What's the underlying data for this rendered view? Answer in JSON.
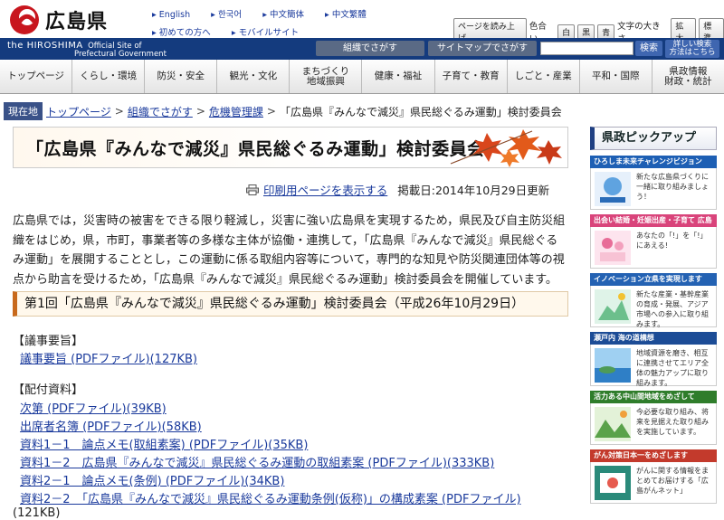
{
  "header": {
    "site_name": "広島県",
    "english_name": "the HIROSHIMA",
    "official_site": "Official Site of",
    "official_site_2": "Prefectural Government",
    "languages": [
      "English",
      "한국어",
      "中文簡体",
      "中文繁體"
    ],
    "links_row2": [
      "初めての方へ",
      "モバイルサイト"
    ],
    "read_aloud": "ページを読み上げ",
    "color_label": "色合い",
    "color_options": [
      "白",
      "黒",
      "青"
    ],
    "size_label": "文字の大きさ",
    "size_options": [
      "拡大",
      "標準"
    ]
  },
  "searchbar": {
    "org_search": "組織でさがす",
    "sitemap_search": "サイトマップでさがす",
    "search_button": "検索",
    "howto_1": "詳しい検索",
    "howto_2": "方法はこちら"
  },
  "global_nav": [
    {
      "label": "トップページ"
    },
    {
      "label": "くらし・環境"
    },
    {
      "label": "防災・安全"
    },
    {
      "label": "観光・文化"
    },
    {
      "label": "まちづくり\n地域振興"
    },
    {
      "label": "健康・福祉"
    },
    {
      "label": "子育て・教育"
    },
    {
      "label": "しごと・産業"
    },
    {
      "label": "平和・国際"
    },
    {
      "label": "県政情報\n財政・統計"
    }
  ],
  "breadcrumb": {
    "current_label": "現在地",
    "items": [
      "トップページ",
      "組織でさがす",
      "危機管理課"
    ],
    "current": "「広島県『みんなで減災』県民総ぐるみ運動」検討委員会"
  },
  "page": {
    "title": "「広島県『みんなで減災』県民総ぐるみ運動」検討委員会",
    "print_link": "印刷用ページを表示する",
    "published": "掲載日:2014年10月29日更新",
    "intro": "広島県では，災害時の被害をできる限り軽減し，災害に強い広島県を実現するため，県民及び自主防災組織をはじめ，県，市町，事業者等の多様な主体が協働・連携して，「広島県『みんなで減災』県民総ぐるみ運動」を展開することとし，この運動に係る取組内容等について，専門的な知見や防災関連団体等の視点から助言を受けるため，「広島県『みんなで減災』県民総ぐるみ運動」検討委員会を開催しています。",
    "section_title": "第1回「広島県『みんなで減災』県民総ぐるみ運動」検討委員会（平成26年10月29日）",
    "summary_heading": "【議事要旨】",
    "summary_link": "議事要旨 (PDFファイル)(127KB)",
    "materials_heading": "【配付資料】",
    "materials": [
      "次第 (PDFファイル)(39KB)",
      "出席者名簿 (PDFファイル)(58KB)",
      "資料1－1　論点メモ(取組素案) (PDFファイル)(35KB)",
      "資料1－2　広島県『みんなで減災』県民総ぐるみ運動の取組素案 (PDFファイル)(333KB)",
      "資料2－1　論点メモ(条例) (PDFファイル)(34KB)",
      "資料2－2　「広島県『みんなで減災』県民総ぐるみ運動条例(仮称)」の構成素案 (PDFファイル)"
    ],
    "trailing_size": "(121KB)"
  },
  "sidebar": {
    "heading": "県政ピックアップ",
    "banners": [
      {
        "title": "ひろしま未来チャレンジビジョン",
        "text": "新たな広島県づくりに一緒に取り組みましょう！",
        "color": "#1d5fb4"
      },
      {
        "title": "出会い結婚・妊娠出産・子育て 広島へ",
        "text": "あなたの「!」を「!」にあえる!",
        "color": "#d9447b"
      },
      {
        "title": "イノベーション立県を実現します",
        "text": "新たな産業・基幹産業の育成・発展、アジア市場への参入に取り組みます。",
        "color": "#2462b3"
      },
      {
        "title": "瀬戸内 海の道構想",
        "text": "地域資源を磨き、相互に連携させてエリア全体の魅力アップに取り組みます。",
        "color": "#1c4c96"
      },
      {
        "title": "活力ある中山間地域をめざして",
        "text": "今必要な取り組み、将来を見据えた取り組みを実施しています。",
        "color": "#2f7d2b"
      },
      {
        "title": "がん対策日本一をめざします",
        "text": "がんに関する情報をまとめてお届けする「広島がんネット」",
        "color": "#c33a2c"
      }
    ]
  }
}
